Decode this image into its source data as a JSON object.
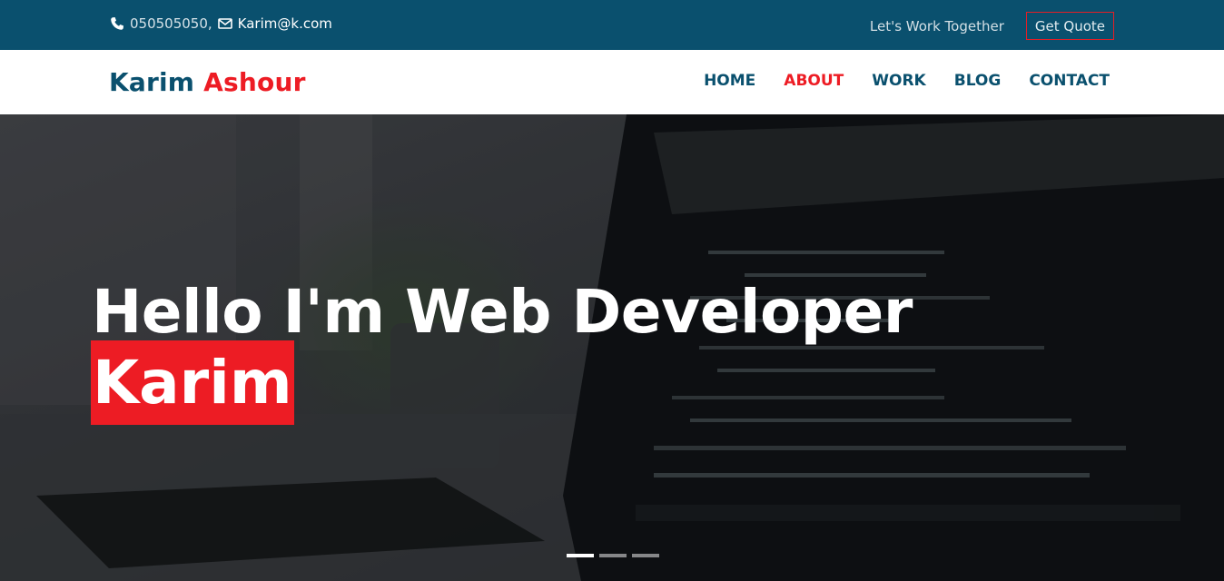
{
  "topbar": {
    "phone": "050505050,",
    "email": "Karim@k.com",
    "work_link": "Let's Work Together",
    "quote_button": "Get Quote",
    "icons": {
      "phone": "phone-icon",
      "email": "envelope-icon"
    }
  },
  "brand": {
    "first": "Karim",
    "last": "Ashour"
  },
  "nav": {
    "items": [
      {
        "label": "HOME"
      },
      {
        "label": "ABOUT",
        "active": true
      },
      {
        "label": "WORK"
      },
      {
        "label": "BLOG"
      },
      {
        "label": "CONTACT"
      }
    ]
  },
  "hero": {
    "headline": "Hello I'm Web Developer",
    "name": "Karim",
    "slides": 3,
    "active_slide": 1
  },
  "colors": {
    "primary": "#0a506e",
    "accent": "#ed1c24",
    "white": "#ffffff"
  }
}
